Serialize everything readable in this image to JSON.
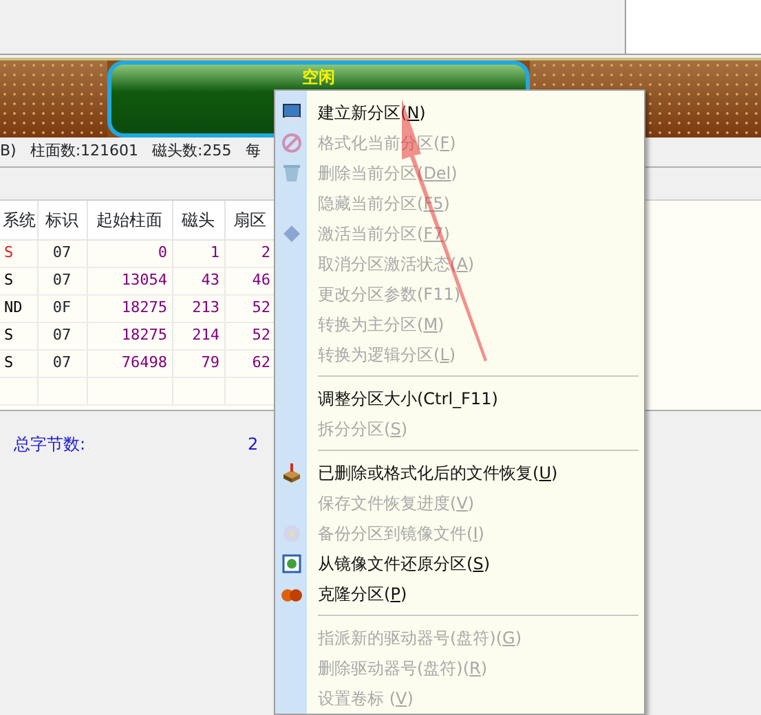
{
  "disk_bar": {
    "free_label": "空闲"
  },
  "disk_info": [
    "B)",
    "柱面数:121601",
    "磁头数:255",
    "每"
  ],
  "table": {
    "columns": [
      "系统",
      "标识",
      "起始柱面",
      "磁头",
      "扇区"
    ],
    "rows": [
      {
        "active": true,
        "cells": [
          "S",
          "07",
          "0",
          "1",
          "2"
        ]
      },
      {
        "active": false,
        "cells": [
          "S",
          "07",
          "13054",
          "43",
          "46"
        ]
      },
      {
        "active": false,
        "cells": [
          "ND",
          "0F",
          "18275",
          "213",
          "52"
        ]
      },
      {
        "active": false,
        "cells": [
          "S",
          "07",
          "18275",
          "214",
          "52"
        ]
      },
      {
        "active": false,
        "cells": [
          "S",
          "07",
          "76498",
          "79",
          "62"
        ]
      }
    ]
  },
  "summary": {
    "label": "总字节数:",
    "value": "2"
  },
  "context_menu": [
    {
      "kind": "item",
      "before": "建立新分区(",
      "key": "N",
      "after": ")",
      "disabled": false
    },
    {
      "kind": "item",
      "before": "格式化当前分区(",
      "key": "F",
      "after": ")",
      "disabled": true
    },
    {
      "kind": "item",
      "before": "删除当前分区(",
      "key": "Del",
      "after": ")",
      "disabled": true
    },
    {
      "kind": "item",
      "before": "隐藏当前分区(",
      "key": "F5",
      "after": ")",
      "disabled": true
    },
    {
      "kind": "item",
      "before": "激活当前分区(",
      "key": "F7",
      "after": ")",
      "disabled": true
    },
    {
      "kind": "item",
      "before": "取消分区激活状态(",
      "key": "A",
      "after": ")",
      "disabled": true
    },
    {
      "kind": "item",
      "before": "更改分区参数(F11)",
      "disabled": true
    },
    {
      "kind": "item",
      "before": "转换为主分区(",
      "key": "M",
      "after": ")",
      "disabled": true
    },
    {
      "kind": "item",
      "before": "转换为逻辑分区(",
      "key": "L",
      "after": ")",
      "disabled": true
    },
    {
      "kind": "separator"
    },
    {
      "kind": "item",
      "before": "调整分区大小(Ctrl_F11)",
      "disabled": false
    },
    {
      "kind": "item",
      "before": "拆分分区(",
      "key": "S",
      "after": ")",
      "disabled": true
    },
    {
      "kind": "separator"
    },
    {
      "kind": "item",
      "before": "已删除或格式化后的文件恢复(",
      "key": "U",
      "after": ")",
      "disabled": false
    },
    {
      "kind": "item",
      "before": "保存文件恢复进度(",
      "key": "V",
      "after": ")",
      "disabled": true
    },
    {
      "kind": "item",
      "before": "备份分区到镜像文件(",
      "key": "I",
      "after": ")",
      "disabled": true
    },
    {
      "kind": "item",
      "before": "从镜像文件还原分区(",
      "key": "S",
      "after": ")",
      "disabled": false
    },
    {
      "kind": "item",
      "before": "克隆分区(",
      "key": "P",
      "after": ")",
      "disabled": false
    },
    {
      "kind": "separator"
    },
    {
      "kind": "item",
      "before": "指派新的驱动器号(盘符)(",
      "key": "G",
      "after": ")",
      "disabled": true
    },
    {
      "kind": "item",
      "before": "删除驱动器号(盘符)(",
      "key": "R",
      "after": ")",
      "disabled": true
    },
    {
      "kind": "item",
      "before": "设置卷标 (",
      "key": "V",
      "after": ")",
      "disabled": true
    }
  ]
}
